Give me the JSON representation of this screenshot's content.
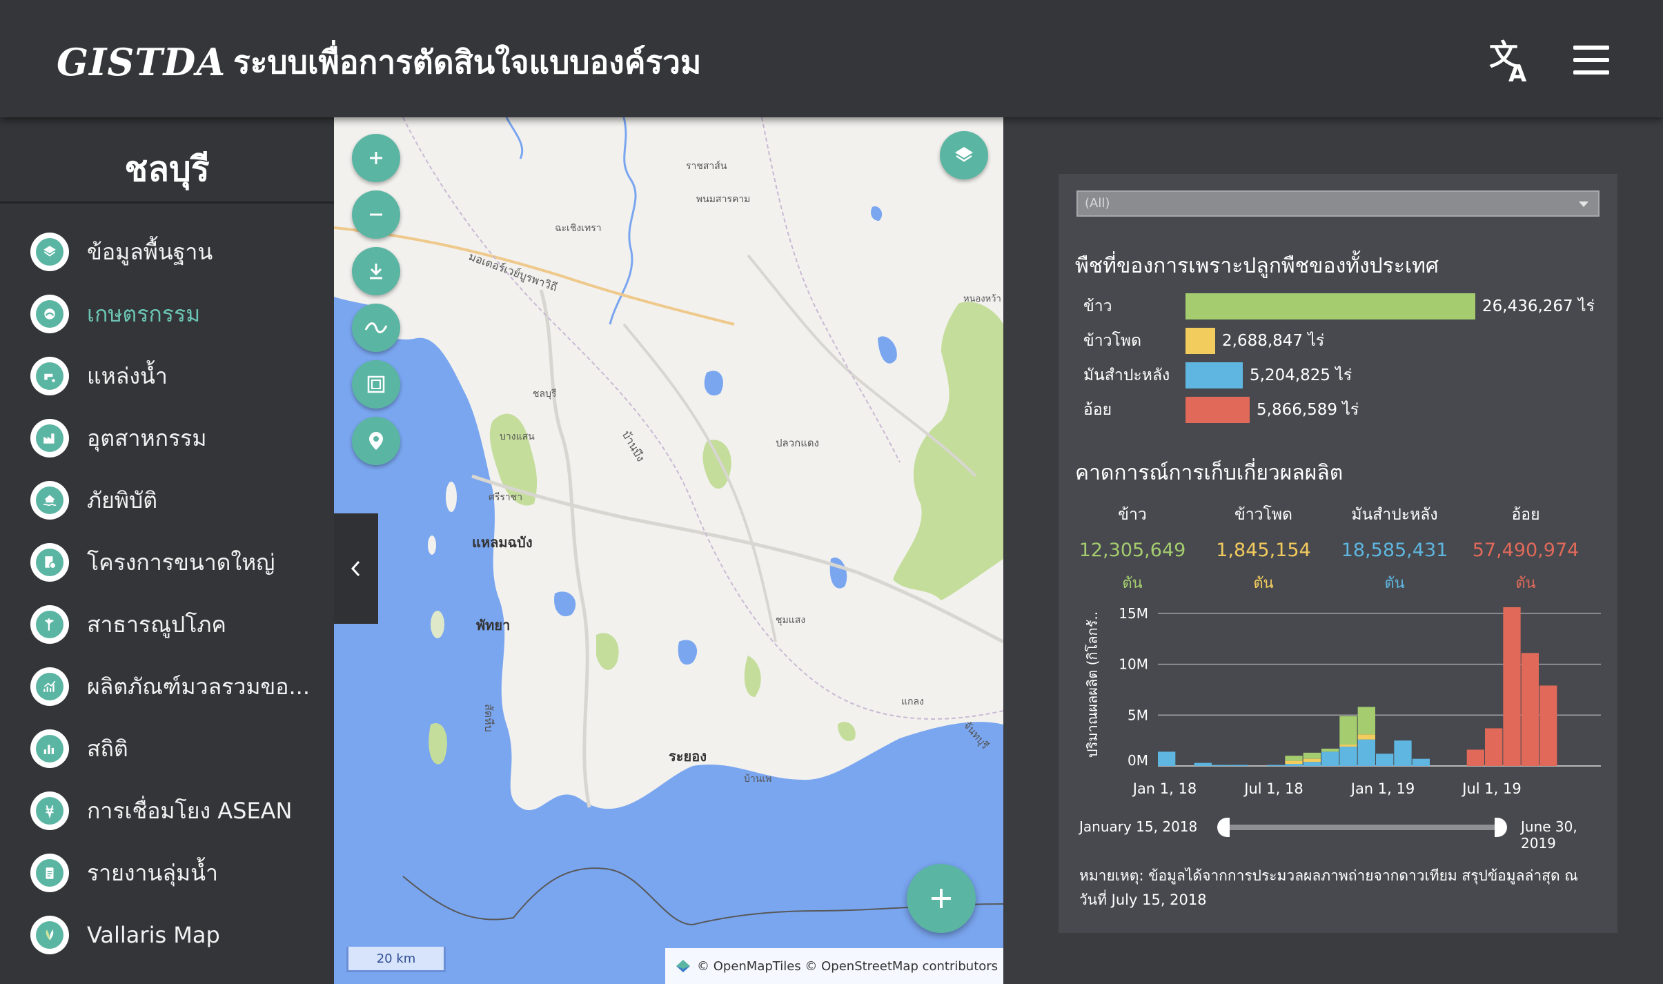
{
  "header": {
    "logo_text": "GISTDA",
    "title": "ระบบเพื่อการตัดสินใจแบบองค์รวม"
  },
  "sidebar": {
    "province": "ชลบุรี",
    "items": [
      {
        "label": "ข้อมูลพื้นฐาน",
        "icon": "layers-icon",
        "active": false
      },
      {
        "label": "เกษตรกรรม",
        "icon": "agriculture-icon",
        "active": true
      },
      {
        "label": "แหล่งน้ำ",
        "icon": "water-tap-icon",
        "active": false
      },
      {
        "label": "อุตสาหกรรม",
        "icon": "factory-icon",
        "active": false
      },
      {
        "label": "ภัยพิบัติ",
        "icon": "flood-house-icon",
        "active": false
      },
      {
        "label": "โครงการขนาดใหญ่",
        "icon": "project-document-icon",
        "active": false
      },
      {
        "label": "สาธารณูปโภค",
        "icon": "utility-pole-icon",
        "active": false
      },
      {
        "label": "ผลิตภัณฑ์มวลรวมขอ...",
        "icon": "growth-chart-icon",
        "active": false
      },
      {
        "label": "สถิติ",
        "icon": "bar-chart-icon",
        "active": false
      },
      {
        "label": "การเชื่อมโยง ASEAN",
        "icon": "asean-icon",
        "active": false
      },
      {
        "label": "รายงานลุ่มน้ำ",
        "icon": "clipboard-icon",
        "active": false
      },
      {
        "label": "Vallaris Map",
        "icon": "vallaris-leaf-icon",
        "active": false
      }
    ]
  },
  "map": {
    "scale_label": "20 km",
    "attribution": "© OpenMapTiles © OpenStreetMap contributors",
    "place_labels": [
      {
        "text": "ราชสาส์น"
      },
      {
        "text": "พนมสารคาม"
      },
      {
        "text": "ฉะเชิงเทรา"
      },
      {
        "text": "มอเตอร์เวย์บูรพาวิถี"
      },
      {
        "text": "หนองหว้า"
      },
      {
        "text": "ชลบุรี"
      },
      {
        "text": "บางแสน"
      },
      {
        "text": "บ้านบึง"
      },
      {
        "text": "ปลวกแดง"
      },
      {
        "text": "ศรีราชา"
      },
      {
        "text": "แหลมฉบัง"
      },
      {
        "text": "พัทยา"
      },
      {
        "text": "ชุมแสง"
      },
      {
        "text": "แกลง"
      },
      {
        "text": "ระยอง"
      },
      {
        "text": "บ้านเพ"
      },
      {
        "text": "สัตหีบ"
      },
      {
        "text": "จันทบุรี"
      }
    ]
  },
  "panel": {
    "dropdown_value": "(All)",
    "area_title": "พืชที่ของการเพราะปลูกพืชของทั้งประเทศ",
    "area_bars": [
      {
        "label": "ข้าว",
        "value": 26436267,
        "display": "26,436,267 ไร่",
        "color": "#a5cd6f"
      },
      {
        "label": "ข้าวโพด",
        "value": 2688847,
        "display": "2,688,847 ไร่",
        "color": "#f3cc5e"
      },
      {
        "label": "มันสำปะหลัง",
        "value": 5204825,
        "display": "5,204,825 ไร่",
        "color": "#5fb6e0"
      },
      {
        "label": "อ้อย",
        "value": 5866589,
        "display": "5,866,589 ไร่",
        "color": "#e0695a"
      }
    ],
    "forecast_title": "คาดการณ์การเก็บเกี่ยวผลผลิต",
    "forecast": [
      {
        "name": "ข้าว",
        "value": "12,305,649",
        "unit": "ตัน",
        "color": "#a5cd6f"
      },
      {
        "name": "ข้าวโพด",
        "value": "1,845,154",
        "unit": "ตัน",
        "color": "#f3cc5e"
      },
      {
        "name": "มันสำปะหลัง",
        "value": "18,585,431",
        "unit": "ตัน",
        "color": "#5fb6e0"
      },
      {
        "name": "อ้อย",
        "value": "57,490,974",
        "unit": "ตัน",
        "color": "#e0695a"
      }
    ],
    "slider": {
      "start_label": "January 15, 2018",
      "end_label": "June 30, 2019",
      "start_fraction": 0.0,
      "end_fraction": 1.0
    },
    "note": "หมายเหตุ: ข้อมูลได้จากการประมวลผลภาพถ่ายจากดาวเทียม สรุปข้อมูลล่าสุด ณ วันที่ July 15, 2018"
  },
  "chart_data": {
    "type": "bar",
    "stacked": true,
    "ylabel": "ปริมาณผลผลิต (กิโลกรั..",
    "xlabel": "",
    "yticks": [
      "0M",
      "5M",
      "10M",
      "15M"
    ],
    "ylim": [
      0,
      16000000
    ],
    "xticks": [
      "Jan 1, 18",
      "Jul 1, 18",
      "Jan 1, 19",
      "Jul 1, 19"
    ],
    "grid": true,
    "categories": [
      "2018-01",
      "2018-02",
      "2018-03",
      "2018-04",
      "2018-05",
      "2018-06",
      "2018-07",
      "2018-08",
      "2018-09",
      "2018-10",
      "2018-11",
      "2018-12",
      "2019-01",
      "2019-02",
      "2019-03",
      "2019-04",
      "2019-05",
      "2019-06",
      "2019-07",
      "2019-08",
      "2019-09",
      "2019-10",
      "2019-11",
      "2019-12"
    ],
    "series": [
      {
        "name": "มันสำปะหลัง",
        "color": "#5fb6e0",
        "values": [
          1400000,
          0,
          300000,
          100000,
          100000,
          0,
          100000,
          200000,
          400000,
          1400000,
          1900000,
          2600000,
          1200000,
          2500000,
          700000,
          0,
          0,
          0,
          0,
          0,
          0,
          0,
          0,
          0
        ]
      },
      {
        "name": "ข้าวโพด",
        "color": "#f3cc5e",
        "values": [
          0,
          0,
          0,
          0,
          0,
          0,
          0,
          300000,
          300000,
          0,
          200000,
          500000,
          0,
          0,
          0,
          0,
          0,
          0,
          0,
          0,
          0,
          0,
          0,
          0
        ]
      },
      {
        "name": "ข้าว",
        "color": "#a5cd6f",
        "values": [
          0,
          0,
          0,
          0,
          0,
          0,
          0,
          500000,
          600000,
          300000,
          2800000,
          2700000,
          0,
          0,
          0,
          0,
          0,
          0,
          0,
          0,
          0,
          0,
          0,
          0
        ]
      },
      {
        "name": "อ้อย",
        "color": "#e0695a",
        "values": [
          0,
          0,
          0,
          0,
          0,
          0,
          0,
          0,
          0,
          0,
          0,
          0,
          0,
          0,
          0,
          0,
          0,
          1600000,
          3700000,
          15600000,
          11100000,
          7900000,
          0,
          0
        ]
      }
    ]
  }
}
